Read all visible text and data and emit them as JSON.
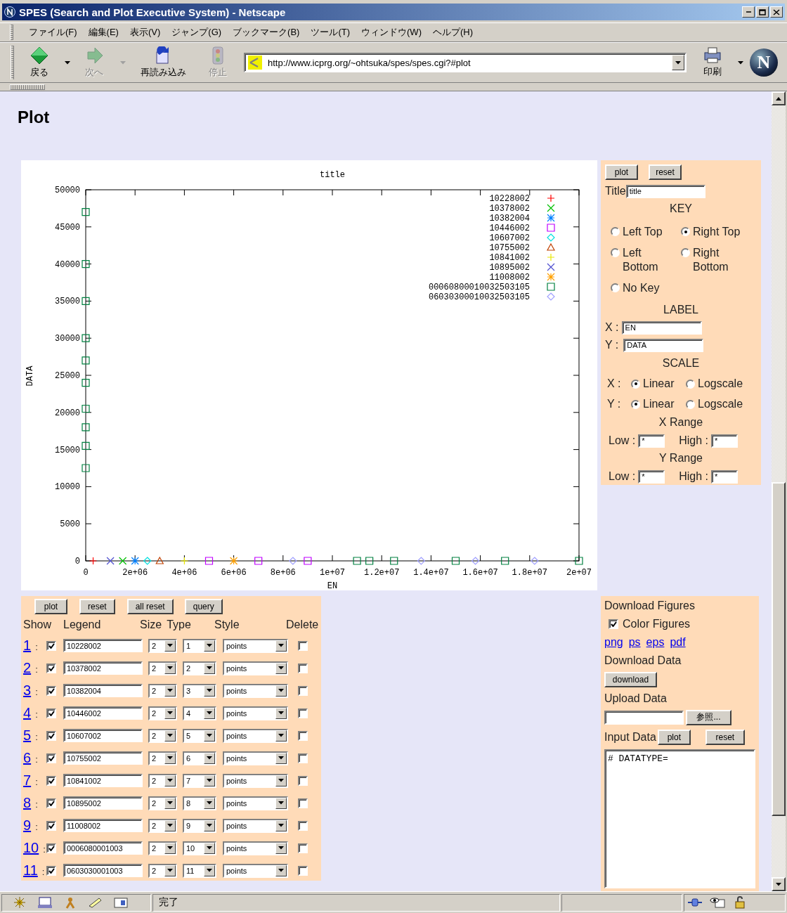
{
  "window": {
    "title": "SPES (Search and Plot Executive System) - Netscape"
  },
  "menu": [
    "ファイル(F)",
    "編集(E)",
    "表示(V)",
    "ジャンプ(G)",
    "ブックマーク(B)",
    "ツール(T)",
    "ウィンドウ(W)",
    "ヘルプ(H)"
  ],
  "toolbar": {
    "buttons": [
      {
        "kind": "back",
        "label": "戻る",
        "disabled": false
      },
      {
        "kind": "forward",
        "label": "次へ",
        "disabled": true
      },
      {
        "kind": "reload",
        "label": "再読み込み",
        "disabled": false
      },
      {
        "kind": "stop",
        "label": "停止",
        "disabled": true
      }
    ],
    "address": "http://www.icprg.org/~ohtsuka/spes/spes.cgi?#plot",
    "print_label": "印刷",
    "logo_letter": "N"
  },
  "page": {
    "heading": "Plot"
  },
  "plot": {
    "chart_data": {
      "type": "scatter",
      "title": "title",
      "xlabel": "EN",
      "ylabel": "DATA",
      "x": [
        0,
        0,
        0,
        0,
        0,
        0,
        0,
        0,
        0,
        0,
        300000,
        1000000,
        1500000,
        2000000,
        2500000,
        3000000,
        4000000,
        5000000,
        6000000,
        7000000,
        8400000,
        9000000,
        11000000,
        11500000,
        12500000,
        13600000,
        15000000,
        15800000,
        17000000,
        18200000,
        20000000
      ],
      "xlim": [
        0,
        20000000
      ],
      "ylim": [
        0,
        50000
      ],
      "xticks": [
        {
          "value": 0,
          "label": "0"
        },
        {
          "value": 2000000,
          "label": "2e+06"
        },
        {
          "value": 4000000,
          "label": "4e+06"
        },
        {
          "value": 6000000,
          "label": "6e+06"
        },
        {
          "value": 8000000,
          "label": "8e+06"
        },
        {
          "value": 10000000,
          "label": "1e+07"
        },
        {
          "value": 12000000,
          "label": "1.2e+07"
        },
        {
          "value": 14000000,
          "label": "1.4e+07"
        },
        {
          "value": 16000000,
          "label": "1.6e+07"
        },
        {
          "value": 18000000,
          "label": "1.8e+07"
        },
        {
          "value": 20000000,
          "label": "2e+07"
        }
      ],
      "yticks": [
        0,
        5000,
        10000,
        15000,
        20000,
        25000,
        30000,
        35000,
        40000,
        45000,
        50000
      ],
      "legend": true,
      "series": [
        {
          "name": "10228002",
          "color": "#ff0000",
          "values": [
            null,
            null,
            null,
            null,
            null,
            null,
            null,
            null,
            null,
            null,
            0,
            null,
            null,
            null,
            null,
            null,
            null,
            null,
            null,
            null,
            null,
            null,
            null,
            null,
            null,
            null,
            null,
            null,
            null,
            null,
            null
          ]
        },
        {
          "name": "10378002",
          "color": "#00c000",
          "values": [
            null,
            null,
            null,
            null,
            null,
            null,
            null,
            null,
            null,
            null,
            null,
            null,
            0,
            null,
            null,
            null,
            null,
            null,
            null,
            null,
            null,
            null,
            null,
            null,
            null,
            null,
            null,
            null,
            null,
            null,
            null
          ]
        },
        {
          "name": "10382004",
          "color": "#0080ff",
          "values": [
            null,
            null,
            null,
            null,
            null,
            null,
            null,
            null,
            null,
            null,
            null,
            null,
            null,
            0,
            null,
            null,
            null,
            null,
            null,
            null,
            null,
            null,
            null,
            null,
            null,
            null,
            null,
            null,
            null,
            null,
            null
          ]
        },
        {
          "name": "10446002",
          "color": "#c000ff",
          "values": [
            null,
            null,
            null,
            null,
            null,
            null,
            null,
            null,
            null,
            null,
            null,
            null,
            null,
            null,
            null,
            null,
            null,
            0,
            null,
            0,
            null,
            0,
            null,
            null,
            null,
            null,
            null,
            null,
            null,
            null,
            null
          ]
        },
        {
          "name": "10607002",
          "color": "#00e0e0",
          "values": [
            null,
            null,
            null,
            null,
            null,
            null,
            null,
            null,
            null,
            null,
            null,
            null,
            null,
            null,
            0,
            null,
            null,
            null,
            null,
            null,
            null,
            null,
            null,
            null,
            null,
            null,
            null,
            null,
            null,
            null,
            null
          ]
        },
        {
          "name": "10755002",
          "color": "#c04000",
          "values": [
            null,
            null,
            null,
            null,
            null,
            null,
            null,
            null,
            null,
            null,
            null,
            null,
            null,
            null,
            null,
            0,
            null,
            null,
            null,
            null,
            null,
            null,
            null,
            null,
            null,
            null,
            null,
            null,
            null,
            null,
            null
          ]
        },
        {
          "name": "10841002",
          "color": "#e8e800",
          "values": [
            null,
            null,
            null,
            null,
            null,
            null,
            null,
            null,
            null,
            null,
            null,
            null,
            null,
            null,
            null,
            null,
            0,
            null,
            null,
            null,
            null,
            null,
            null,
            null,
            null,
            null,
            null,
            null,
            null,
            null,
            null
          ]
        },
        {
          "name": "10895002",
          "color": "#5050d0",
          "values": [
            null,
            null,
            null,
            null,
            null,
            null,
            null,
            null,
            null,
            null,
            null,
            0,
            null,
            null,
            null,
            null,
            null,
            null,
            null,
            null,
            null,
            null,
            null,
            null,
            null,
            null,
            null,
            null,
            null,
            null,
            null
          ]
        },
        {
          "name": "11008002",
          "color": "#ffa000",
          "values": [
            null,
            null,
            null,
            null,
            null,
            null,
            null,
            null,
            null,
            null,
            null,
            null,
            null,
            null,
            null,
            null,
            null,
            null,
            0,
            null,
            null,
            null,
            null,
            null,
            null,
            null,
            null,
            null,
            null,
            null,
            null
          ]
        },
        {
          "name": "00060800010032503105",
          "color": "#008040",
          "values": [
            47000,
            40000,
            35000,
            30000,
            27000,
            24000,
            20500,
            18000,
            15500,
            12500,
            null,
            null,
            null,
            null,
            null,
            null,
            null,
            null,
            null,
            null,
            null,
            null,
            0,
            0,
            0,
            null,
            0,
            null,
            0,
            null,
            0
          ]
        },
        {
          "name": "06030300010032503105",
          "color": "#a0a0ff",
          "values": [
            null,
            null,
            null,
            null,
            null,
            null,
            null,
            null,
            null,
            null,
            null,
            null,
            null,
            null,
            null,
            null,
            null,
            null,
            null,
            null,
            0,
            null,
            null,
            null,
            null,
            0,
            null,
            0,
            null,
            0,
            null
          ]
        }
      ]
    }
  },
  "plot_settings": {
    "buttons": [
      "plot",
      "reset"
    ],
    "title_label": "Title",
    "title_value": "title",
    "key_heading": "KEY",
    "key_options": [
      {
        "label": "Left Top",
        "selected": false
      },
      {
        "label": "Right Top",
        "selected": true
      },
      {
        "label": "Left Bottom",
        "selected": false
      },
      {
        "label": "Right Bottom",
        "selected": false
      },
      {
        "label": "No Key",
        "selected": false
      }
    ],
    "label_heading": "LABEL",
    "x_label": "X :",
    "x_value": "EN",
    "y_label": "Y :",
    "y_value": "DATA",
    "scale_heading": "SCALE",
    "scales": [
      {
        "axis": "X :",
        "options": [
          {
            "label": "Linear",
            "selected": true
          },
          {
            "label": "Logscale",
            "selected": false
          }
        ]
      },
      {
        "axis": "Y :",
        "options": [
          {
            "label": "Linear",
            "selected": true
          },
          {
            "label": "Logscale",
            "selected": false
          }
        ]
      }
    ],
    "ranges": [
      {
        "heading": "X Range",
        "low_label": "Low :",
        "low": "*",
        "high_label": "High :",
        "high": "*"
      },
      {
        "heading": "Y Range",
        "low_label": "Low :",
        "low": "*",
        "high_label": "High :",
        "high": "*"
      }
    ]
  },
  "series_table": {
    "buttons": [
      "plot",
      "reset",
      "all reset",
      "query"
    ],
    "columns": [
      "Show",
      "Legend",
      "Size",
      "Type",
      "Style",
      "Delete"
    ],
    "rows": [
      {
        "number": "1",
        "separator": ":",
        "show": true,
        "legend": "10228002",
        "size": "2",
        "type": "1",
        "style": "points",
        "delete": false
      },
      {
        "number": "2",
        "separator": ":",
        "show": true,
        "legend": "10378002",
        "size": "2",
        "type": "2",
        "style": "points",
        "delete": false
      },
      {
        "number": "3",
        "separator": ":",
        "show": true,
        "legend": "10382004",
        "size": "2",
        "type": "3",
        "style": "points",
        "delete": false
      },
      {
        "number": "4",
        "separator": ":",
        "show": true,
        "legend": "10446002",
        "size": "2",
        "type": "4",
        "style": "points",
        "delete": false
      },
      {
        "number": "5",
        "separator": ":",
        "show": true,
        "legend": "10607002",
        "size": "2",
        "type": "5",
        "style": "points",
        "delete": false
      },
      {
        "number": "6",
        "separator": ":",
        "show": true,
        "legend": "10755002",
        "size": "2",
        "type": "6",
        "style": "points",
        "delete": false
      },
      {
        "number": "7",
        "separator": ":",
        "show": true,
        "legend": "10841002",
        "size": "2",
        "type": "7",
        "style": "points",
        "delete": false
      },
      {
        "number": "8",
        "separator": ":",
        "show": true,
        "legend": "10895002",
        "size": "2",
        "type": "8",
        "style": "points",
        "delete": false
      },
      {
        "number": "9",
        "separator": ":",
        "show": true,
        "legend": "11008002",
        "size": "2",
        "type": "9",
        "style": "points",
        "delete": false
      },
      {
        "number": "10",
        "separator": ":",
        "show": true,
        "legend": "0006080001003",
        "size": "2",
        "type": "10",
        "style": "points",
        "delete": false
      },
      {
        "number": "11",
        "separator": ":",
        "show": true,
        "legend": "0603030001003",
        "size": "2",
        "type": "11",
        "style": "points",
        "delete": false
      }
    ]
  },
  "data_panel": {
    "figures_heading": "Download Figures",
    "color_figures": {
      "label": "Color Figures",
      "checked": true
    },
    "formats": [
      "png",
      "ps",
      "eps",
      "pdf"
    ],
    "data_heading": "Download Data",
    "download_button": "download",
    "upload_heading": "Upload Data",
    "browse_button": "参照...",
    "input_heading": "Input Data",
    "input_buttons": [
      "plot",
      "reset"
    ],
    "input_text": "# DATATYPE="
  },
  "status_bar": {
    "text": "完了"
  }
}
